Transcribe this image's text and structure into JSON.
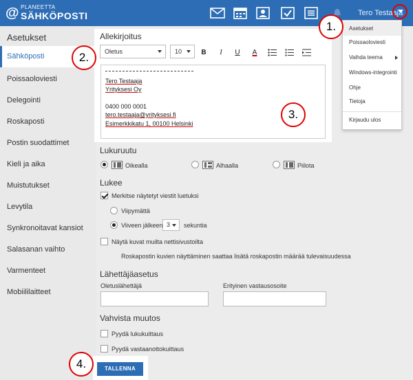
{
  "header": {
    "logo_small": "PLANEETTA",
    "logo_big": "SÄHKÖPOSTI",
    "logo_at": "@",
    "user_name": "Tero Testaaja",
    "icons": [
      "mail-icon",
      "calendar-icon",
      "contacts-icon",
      "tasks-icon",
      "notes-icon",
      "bell-icon"
    ],
    "accent_color": "#2d6db5"
  },
  "sidebar": {
    "title": "Asetukset",
    "items": [
      {
        "label": "Sähköposti",
        "active": true
      },
      {
        "label": "Poissaoloviesti"
      },
      {
        "label": "Delegointi"
      },
      {
        "label": "Roskaposti"
      },
      {
        "label": "Postin suodattimet"
      },
      {
        "label": "Kieli ja aika"
      },
      {
        "label": "Muistutukset"
      },
      {
        "label": "Levytila"
      },
      {
        "label": "Synkronoitavat kansiot"
      },
      {
        "label": "Salasanan vaihto"
      },
      {
        "label": "Varmenteet"
      },
      {
        "label": "Mobiililaitteet"
      }
    ]
  },
  "signature": {
    "title": "Allekirjoitus",
    "font_value": "Oletus",
    "size_value": "10",
    "format_buttons": [
      "B",
      "I",
      "U",
      "A"
    ],
    "lines": [
      "Tero Testaaja",
      "Yrityksesi Oy",
      "0400 000 0001",
      "tero.testaaja@yrityksesi.fi",
      "Esimerkkikatu 1, 00100 Helsinki"
    ]
  },
  "reading_pane": {
    "title": "Lukuruutu",
    "options": [
      "Oikealla",
      "Alhaalla",
      "Piilota"
    ],
    "selected": 0
  },
  "reading": {
    "title": "Lukee",
    "mark_read_label": "Merkitse näytetyt viestit luetuksi",
    "mark_read_checked": true,
    "immediately_label": "Viipymättä",
    "after_label": "Viiveen jälkeen",
    "delay_value": "3",
    "seconds_label": "sekuntia",
    "show_images_label": "Näytä kuvat muilta nettisivustoilta",
    "junk_note": "Roskapostin kuvien näyttäminen saattaa lisätä roskapostin määrää tulevaisuudessa"
  },
  "sender": {
    "title": "Lähettäjäasetus",
    "default_sender_label": "Oletuslähettäjä",
    "default_sender_value": "",
    "reply_to_label": "Erityinen vastausosoite",
    "reply_to_value": ""
  },
  "confirm": {
    "title": "Vahvista muutos",
    "read_receipt_label": "Pyydä lukukuittaus",
    "delivery_receipt_label": "Pyydä vastaanottokuittaus"
  },
  "save_label": "TALLENNA",
  "menu": {
    "items": [
      "Asetukset",
      "Poissaoloviesti",
      "Vaihda teema",
      "Windows-integrointi",
      "Ohje",
      "Tietoja",
      "Kirjaudu ulos"
    ]
  },
  "callouts": [
    "1.",
    "2.",
    "3.",
    "4."
  ]
}
